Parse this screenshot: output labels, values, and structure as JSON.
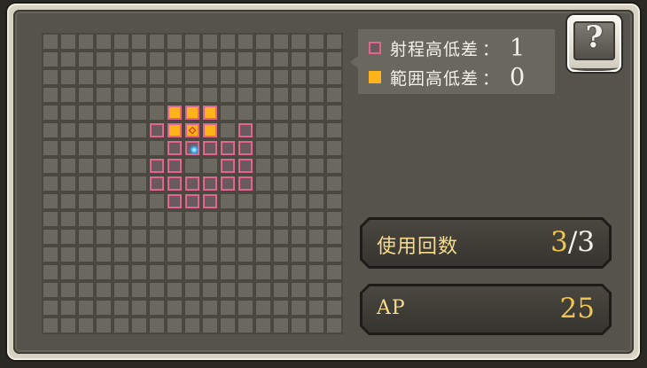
{
  "grid": {
    "cols": 17,
    "rows": 17,
    "range_cells": [
      [
        6,
        7
      ],
      [
        6,
        8
      ],
      [
        6,
        9
      ],
      [
        6,
        10
      ],
      [
        6,
        11
      ],
      [
        7,
        6
      ],
      [
        7,
        7
      ],
      [
        7,
        10
      ],
      [
        7,
        11
      ],
      [
        8,
        6
      ],
      [
        8,
        7
      ],
      [
        8,
        8
      ],
      [
        8,
        9
      ],
      [
        8,
        10
      ],
      [
        8,
        11
      ],
      [
        9,
        7
      ],
      [
        9,
        8
      ],
      [
        9,
        9
      ],
      [
        5,
        6
      ],
      [
        5,
        11
      ]
    ],
    "effect_cells": [
      [
        4,
        7
      ],
      [
        4,
        8
      ],
      [
        4,
        9
      ],
      [
        5,
        7
      ],
      [
        5,
        9
      ]
    ],
    "target_cell": [
      5,
      8
    ],
    "caster_cell": [
      6,
      8
    ]
  },
  "legend": {
    "range_label": "射程高低差",
    "range_colon": "：",
    "range_value": "1",
    "area_label": "範囲高低差",
    "area_colon": "：",
    "area_value": "0"
  },
  "help": {
    "label": "?"
  },
  "stats": {
    "uses_label": "使用回数",
    "uses_current": "3",
    "uses_slash": "/",
    "uses_max": "3",
    "ap_label": "AP",
    "ap_value": "25"
  },
  "colors": {
    "range_border": "#e2658d",
    "effect_fill": "#ffb219",
    "caster": "#41b8ff",
    "value_gold": "#f1c44f"
  }
}
